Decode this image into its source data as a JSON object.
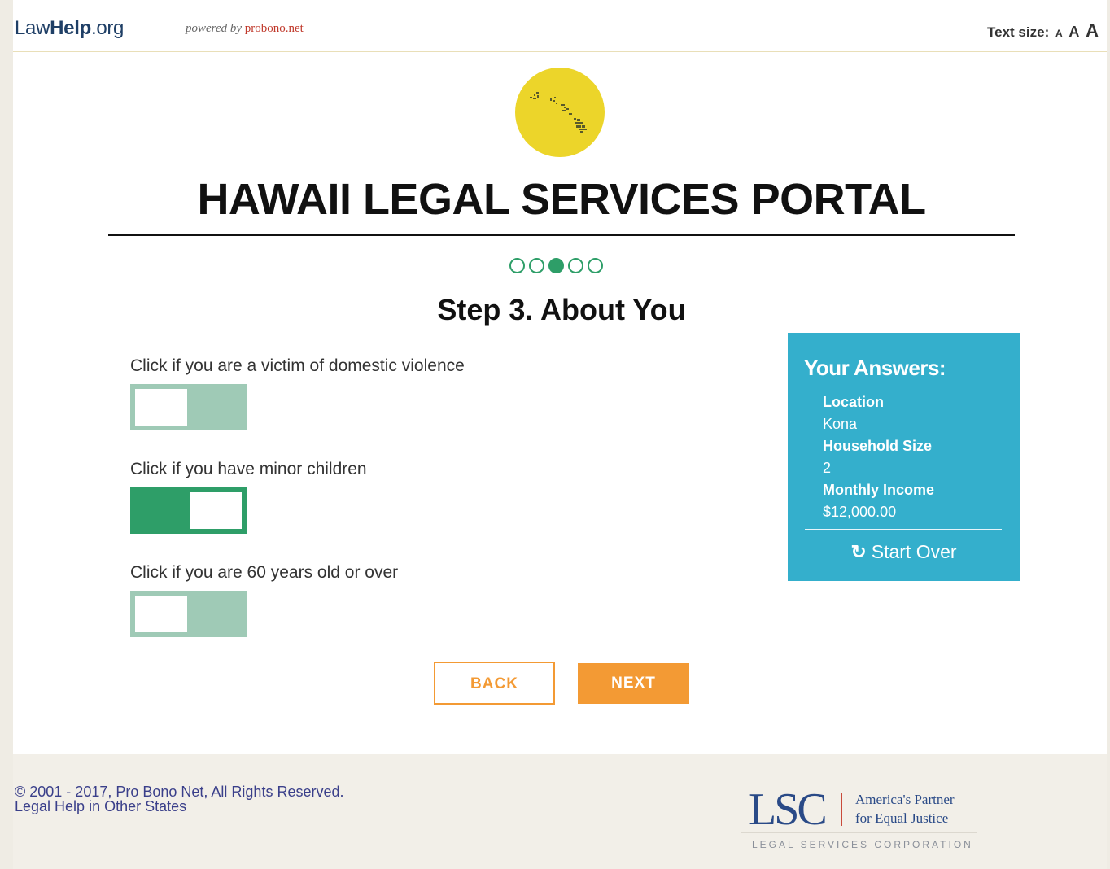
{
  "header": {
    "logo_prefix": "Law",
    "logo_bold": "Help",
    "logo_suffix": ".org",
    "powered_by": "powered by",
    "powered_brand": "probono.net",
    "text_size_label": "Text size:",
    "text_size_options": [
      "A",
      "A",
      "A"
    ]
  },
  "hero": {
    "title": "HAWAII LEGAL SERVICES PORTAL",
    "emblem_icon": "hawaii-islands-map-icon"
  },
  "progress": {
    "total_steps": 5,
    "current_step": 3
  },
  "step": {
    "title": "Step 3. About You"
  },
  "questions": [
    {
      "label": "Click if you are a victim of domestic violence",
      "checked": false
    },
    {
      "label": "Click if you have minor children",
      "checked": true
    },
    {
      "label": "Click if you are 60 years old or over",
      "checked": false
    }
  ],
  "answers": {
    "title": "Your Answers:",
    "items": [
      {
        "label": "Location",
        "value": "Kona"
      },
      {
        "label": "Household Size",
        "value": "2"
      },
      {
        "label": "Monthly Income",
        "value": "$12,000.00"
      }
    ],
    "start_over_icon": "refresh-icon",
    "start_over": "Start Over"
  },
  "buttons": {
    "back": "BACK",
    "next": "NEXT"
  },
  "footer": {
    "copyright": "© 2001 - 2017, Pro Bono Net, All Rights Reserved.",
    "other_states": "Legal Help in Other States",
    "lsc_mark": "LSC",
    "lsc_tagline_1": "America's Partner",
    "lsc_tagline_2": "for Equal Justice",
    "lsc_sub": "LEGAL SERVICES CORPORATION"
  },
  "colors": {
    "accent_green": "#2e9e68",
    "toggle_off": "#9fcab6",
    "panel_blue": "#34afcc",
    "button_orange": "#f39a34",
    "emblem_yellow": "#ecd52a",
    "link_blue": "#3a3f8a"
  }
}
